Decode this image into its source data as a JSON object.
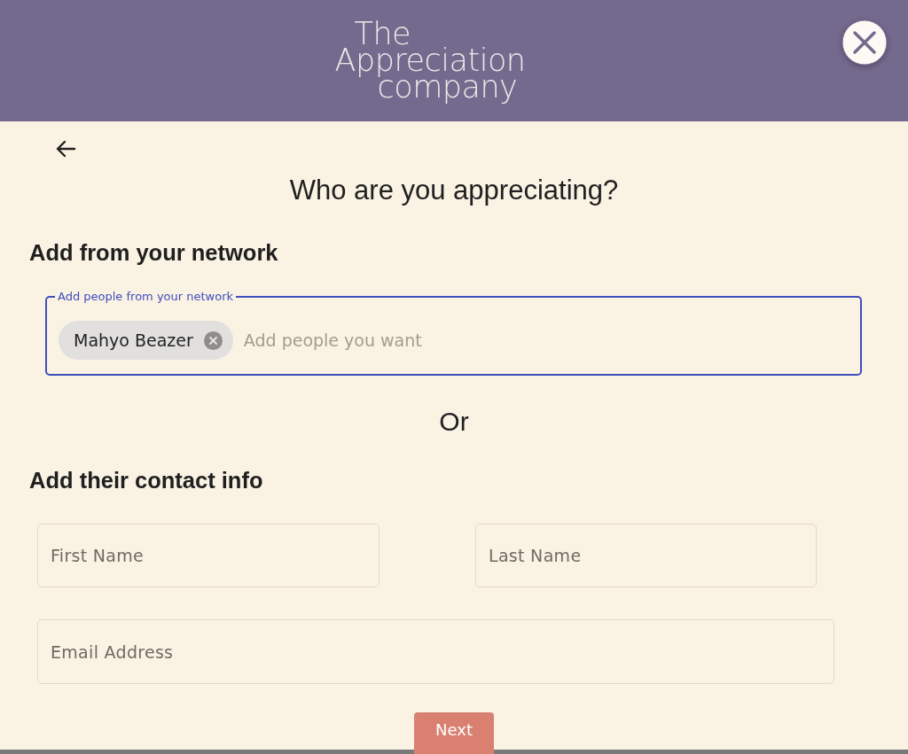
{
  "header": {
    "logo": [
      "The",
      "Appreciation",
      "company"
    ]
  },
  "title": "Who are you appreciating?",
  "network_section": {
    "heading": "Add from your network",
    "field": {
      "label": "Add people from your network",
      "focused": true,
      "chips": [
        {
          "label": "Mahyo Beazer"
        }
      ],
      "placeholder": "Add people you want"
    }
  },
  "divider_text": "Or",
  "contact_section": {
    "heading": "Add their contact info",
    "fields": [
      {
        "placeholder": "First Name",
        "kind": "half"
      },
      {
        "placeholder": "Last Name",
        "kind": "half"
      },
      {
        "placeholder": "Email Address",
        "kind": "full"
      }
    ]
  },
  "next_button": "Next"
}
